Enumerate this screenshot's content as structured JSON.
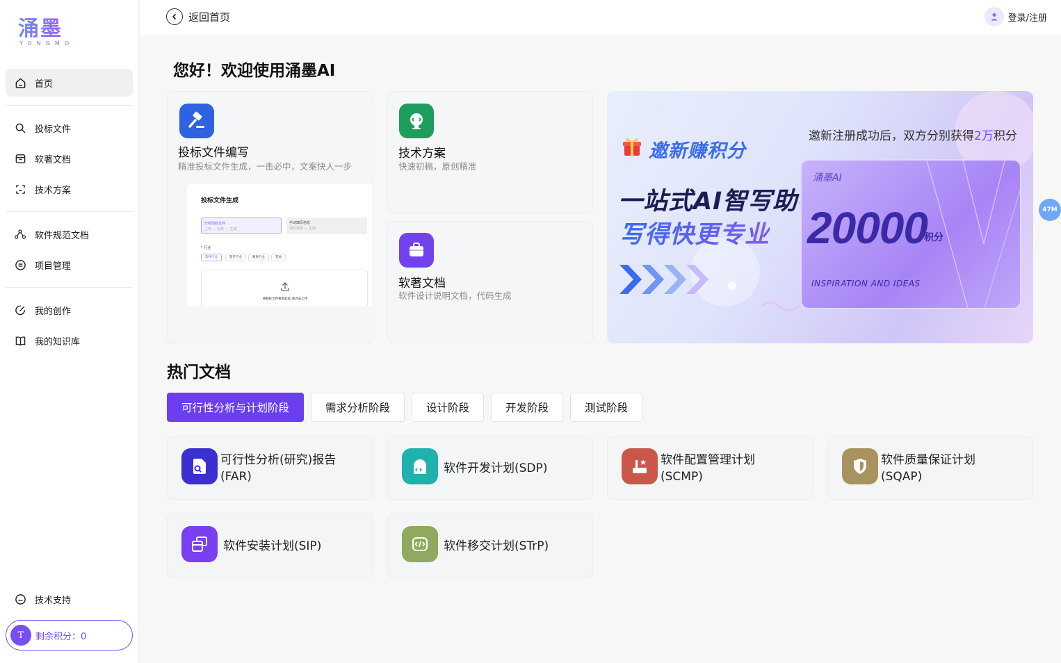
{
  "brand": {
    "name_cn": "涌墨",
    "name_en": "YONGMO"
  },
  "sidebar": {
    "items": [
      {
        "label": "首页",
        "icon": "home-icon"
      },
      {
        "label": "投标文件",
        "icon": "search-icon"
      },
      {
        "label": "软著文档",
        "icon": "archive-icon"
      },
      {
        "label": "技术方案",
        "icon": "scan-icon"
      },
      {
        "label": "软件规范文档",
        "icon": "nodes-icon"
      },
      {
        "label": "项目管理",
        "icon": "list-icon"
      },
      {
        "label": "我的创作",
        "icon": "edit-icon"
      },
      {
        "label": "我的知识库",
        "icon": "book-icon"
      }
    ],
    "support_label": "技术支持",
    "credits_label": "剩余积分：0",
    "credits_badge": "T"
  },
  "topbar": {
    "back_label": "返回首页",
    "login_label": "登录/注册"
  },
  "welcome": "您好！欢迎使用涌墨AI",
  "features": {
    "bid": {
      "title": "投标文件编写",
      "subtitle": "精准投标文件生成，一击必中，文案快人一步",
      "preview": {
        "title": "投标文件生成",
        "option1": "分析招标文件",
        "option1_sub": "上传 — 分析 — 生成",
        "option2": "手动填写信息",
        "option2_sub": "填写表单 — 生成",
        "industry_label": "* 行业",
        "chips": [
          "软件行业",
          "医疗行业",
          "教育行业",
          "其他"
        ],
        "upload_text": "将招标文件拖到此处,或点击上传"
      }
    },
    "tech": {
      "title": "技术方案",
      "subtitle": "快速初稿，原创精准"
    },
    "copyright": {
      "title": "软著文档",
      "subtitle": "软件设计说明文档，代码生成"
    }
  },
  "banner": {
    "invite": "邀新赚积分",
    "top_text_prefix": "邀新注册成功后，双方分别获得",
    "top_text_highlight": "2万",
    "top_text_suffix": "积分",
    "headline1": "一站式AI智写助手",
    "headline2": "写得快更专业",
    "ticket_brand": "涌墨AI",
    "ticket_number": "20000",
    "ticket_unit": "积分",
    "ticket_en": "INSPIRATION AND IDEAS"
  },
  "memory_badge": "47M",
  "hot": {
    "title": "热门文档",
    "tabs": [
      "可行性分析与计划阶段",
      "需求分析阶段",
      "设计阶段",
      "开发阶段",
      "测试阶段"
    ],
    "docs": [
      {
        "line1": "可行性分析(研究)报告",
        "line2": "(FAR)",
        "color": "#3b2fd1",
        "icon": "document-search-icon"
      },
      {
        "line1": "软件开发计划(SDP)",
        "line2": "",
        "color": "#1fb1ad",
        "icon": "code-document-icon"
      },
      {
        "line1": "软件配置管理计划",
        "line2": "(SCMP)",
        "color": "#c9574a",
        "icon": "config-icon"
      },
      {
        "line1": "软件质量保证计划",
        "line2": "(SQAP)",
        "color": "#a8935f",
        "icon": "shield-icon"
      },
      {
        "line1": "软件安装计划(SIP)",
        "line2": "",
        "color": "#7a3ff0",
        "icon": "install-icon"
      },
      {
        "line1": "软件移交计划(STrP)",
        "line2": "",
        "color": "#8faa5e",
        "icon": "handover-code-icon"
      }
    ]
  }
}
